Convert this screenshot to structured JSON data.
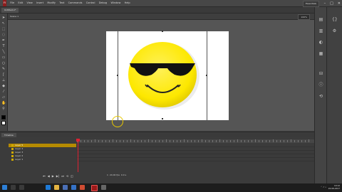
{
  "menubar": {
    "items": [
      "Fl",
      "File",
      "Edit",
      "View",
      "Insert",
      "Modify",
      "Text",
      "Commands",
      "Control",
      "Debug",
      "Window",
      "Help"
    ],
    "workspace": "Essentials",
    "window_controls": [
      "–",
      "□",
      "✕"
    ]
  },
  "document": {
    "tab_label": "Untitled-1*",
    "scene": "Scene 1",
    "zoom": "100%"
  },
  "tools": [
    "arrow-icon",
    "subselect-icon",
    "free-transform-icon",
    "lasso-icon",
    "pen-icon",
    "text-icon",
    "line-icon",
    "rectangle-icon",
    "oval-icon",
    "pencil-icon",
    "brush-icon",
    "bone-icon",
    "paint-bucket-icon",
    "eyedropper-icon",
    "eraser-icon",
    "hand-icon",
    "zoom-icon",
    "stroke-color-icon",
    "fill-color-icon"
  ],
  "panels": {
    "right_icons": [
      "properties-icon",
      "library-icon",
      "color-icon",
      "swatches-icon",
      "align-icon",
      "info-icon",
      "transform-icon",
      "code-snippets-icon",
      "components-icon"
    ]
  },
  "timeline": {
    "tab_label": "Timeline",
    "layers": [
      {
        "name": "Layer 5"
      },
      {
        "name": "Layer 4"
      },
      {
        "name": "Layer 3"
      },
      {
        "name": "Layer 2"
      },
      {
        "name": "Layer 1"
      }
    ],
    "current_frame": "1",
    "frame_rate": "24.00 fps",
    "elapsed": "0.0 s"
  },
  "taskbar": {
    "apps": [
      "start-icon",
      "search-icon",
      "task-view-icon",
      "edge-icon",
      "explorer-icon",
      "store-icon",
      "mail-icon",
      "chrome-icon",
      "animate-icon",
      "media-icon"
    ],
    "time": "10:12",
    "date": "22-06-2017"
  },
  "colors": {
    "stage": "#ffffff",
    "smiley": "#fde800",
    "glasses": "#111111",
    "playhead": "#dd2233",
    "layer_selected": "#b58a00"
  }
}
